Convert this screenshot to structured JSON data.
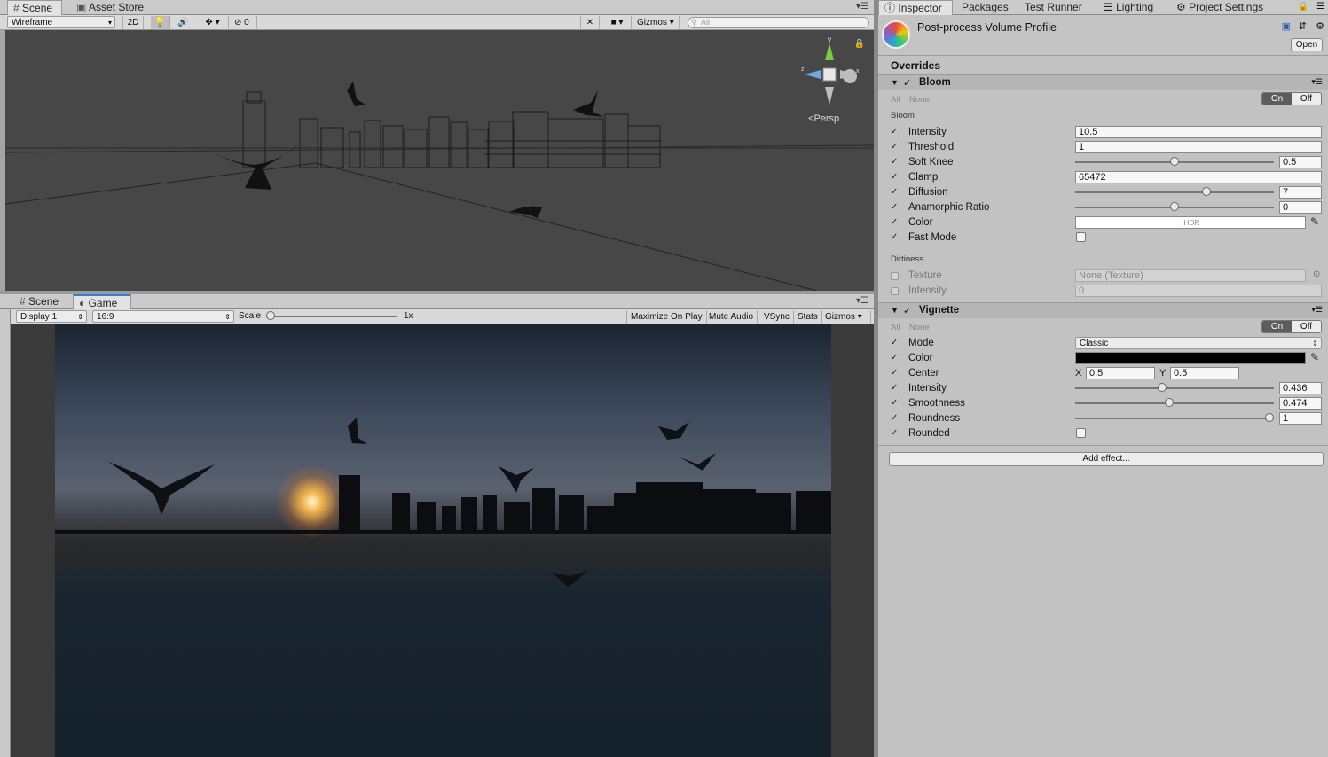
{
  "scene_panel": {
    "tabs": [
      {
        "label": "Scene",
        "icon": "grid-icon"
      },
      {
        "label": "Asset Store",
        "icon": "store-icon"
      }
    ],
    "draw_mode": "Wireframe",
    "mode_2d": "2D",
    "hidden_count": "0",
    "gizmos_label": "Gizmos",
    "search_placeholder": "All",
    "persp_label": "Persp"
  },
  "game_panel": {
    "tabs": [
      {
        "label": "Scene"
      },
      {
        "label": "Game"
      }
    ],
    "display": "Display 1",
    "aspect": "16:9",
    "scale_label": "Scale",
    "scale_value": "1x",
    "scale_level": 0.0,
    "buttons": [
      "Maximize On Play",
      "Mute Audio",
      "VSync",
      "Stats"
    ],
    "gizmos_label": "Gizmos"
  },
  "inspector": {
    "tabs": [
      "Inspector",
      "Packages",
      "Test Runner",
      "Lighting",
      "Project Settings"
    ],
    "asset_title": "Post-process Volume Profile",
    "open_button": "Open",
    "overrides_label": "Overrides",
    "all_label": "All",
    "none_label": "None",
    "on_label": "On",
    "off_label": "Off",
    "bloom": {
      "title": "Bloom",
      "section_label": "Bloom",
      "intensity": {
        "label": "Intensity",
        "value": "10.5"
      },
      "threshold": {
        "label": "Threshold",
        "value": "1"
      },
      "soft_knee": {
        "label": "Soft Knee",
        "value": "0.5",
        "level": 0.5
      },
      "clamp": {
        "label": "Clamp",
        "value": "65472"
      },
      "diffusion": {
        "label": "Diffusion",
        "value": "7",
        "level": 0.667
      },
      "anamorphic": {
        "label": "Anamorphic Ratio",
        "value": "0",
        "level": 0.5
      },
      "color": {
        "label": "Color",
        "value": "HDR",
        "swatch": "#ffffff"
      },
      "fast_mode": {
        "label": "Fast Mode"
      },
      "dirtiness_label": "Dirtiness",
      "texture": {
        "label": "Texture",
        "value": "None (Texture)"
      },
      "dirt_intensity": {
        "label": "Intensity",
        "value": "0"
      }
    },
    "vignette": {
      "title": "Vignette",
      "mode": {
        "label": "Mode",
        "value": "Classic"
      },
      "color": {
        "label": "Color",
        "swatch": "#000000"
      },
      "center": {
        "label": "Center",
        "x_label": "X",
        "x": "0.5",
        "y_label": "Y",
        "y": "0.5"
      },
      "intensity": {
        "label": "Intensity",
        "value": "0.436",
        "level": 0.436
      },
      "smoothness": {
        "label": "Smoothness",
        "value": "0.474",
        "level": 0.474
      },
      "roundness": {
        "label": "Roundness",
        "value": "1",
        "level": 1.0
      },
      "rounded": {
        "label": "Rounded"
      }
    },
    "add_effect_button": "Add effect..."
  }
}
